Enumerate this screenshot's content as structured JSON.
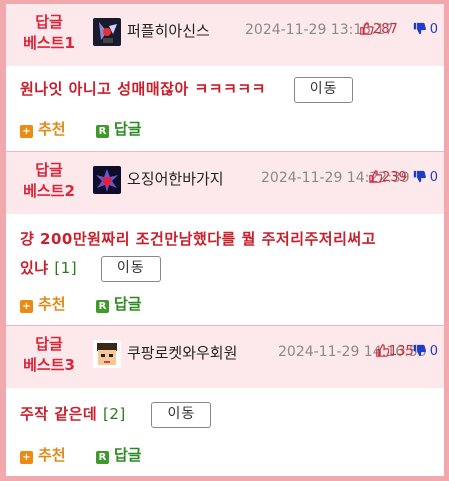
{
  "posts": [
    {
      "best_label_1": "답글",
      "best_label_2": "베스트1",
      "user": "퍼플히아신스",
      "date": "2024-11-29 13:15:17",
      "up": "287",
      "down": "0",
      "title": "원나잇 아니고 성매매잖아 ㅋㅋㅋㅋㅋ",
      "comment_count": "",
      "move_label": "이동",
      "recommend_label": "추천",
      "reply_label": "답글",
      "avatar_icon": "character-avatar-icon"
    },
    {
      "best_label_1": "답글",
      "best_label_2": "베스트2",
      "user": "오징어한바가지",
      "date": "2024-11-29 14:22:39",
      "up": "239",
      "down": "0",
      "title_line1": "걍 200만원짜리 조건만남했다를 뭘 주저리주저리써고",
      "title_line2": "있냐",
      "comment_count": "[1]",
      "move_label": "이동",
      "recommend_label": "추천",
      "reply_label": "답글",
      "avatar_icon": "heart-avatar-icon"
    },
    {
      "best_label_1": "답글",
      "best_label_2": "베스트3",
      "user": "쿠팡로켓와우회원",
      "date": "2024-11-29 14:16:50",
      "up": "135",
      "down": "0",
      "title": "주작 같은데",
      "comment_count": "[2]",
      "move_label": "이동",
      "recommend_label": "추천",
      "reply_label": "답글",
      "avatar_icon": "pixel-face-avatar-icon"
    }
  ],
  "colors": {
    "best_red": "#d9263a",
    "header_pink": "#fde9eb",
    "border_pink": "#f2a9ae",
    "recommend_orange": "#ec8a14",
    "reply_green": "#3f9a2b",
    "down_blue": "#1d3cc8"
  }
}
